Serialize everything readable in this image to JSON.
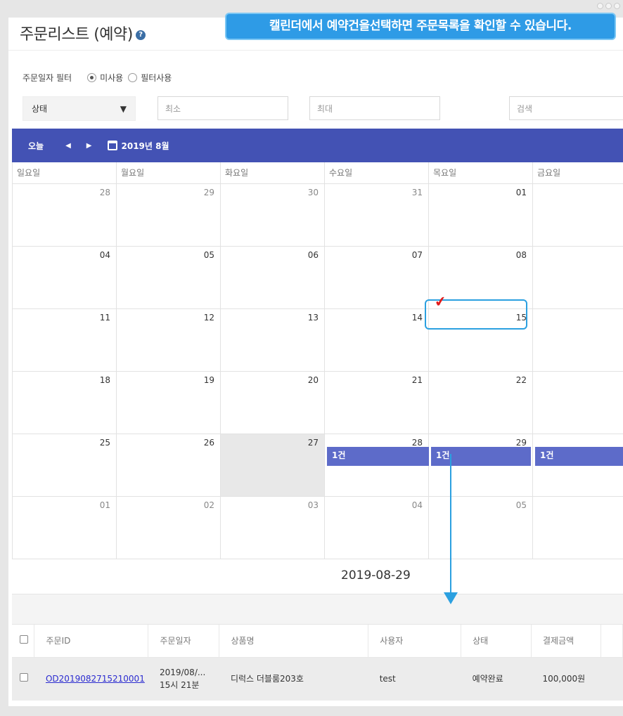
{
  "title": "주문리스트 (예약)",
  "callout": "캘린더에서 예약건을선택하면 주문목록을 확인할 수 있습니다.",
  "filter": {
    "label": "주문일자 필터",
    "options": [
      "미사용",
      "필터사용"
    ],
    "selected": "미사용"
  },
  "search": {
    "status_label": "상태",
    "min_placeholder": "최소",
    "max_placeholder": "최대",
    "search_placeholder": "검색"
  },
  "calendar": {
    "today_label": "오늘",
    "prev_icon": "◀",
    "next_icon": "▶",
    "month_label": "2019년 8월",
    "weekdays": [
      "일요일",
      "월요일",
      "화요일",
      "수요일",
      "목요일",
      "금요일"
    ],
    "weeks": [
      [
        "28",
        "29",
        "30",
        "31",
        "01",
        ""
      ],
      [
        "04",
        "05",
        "06",
        "07",
        "08",
        ""
      ],
      [
        "11",
        "12",
        "13",
        "14",
        "15",
        ""
      ],
      [
        "18",
        "19",
        "20",
        "21",
        "22",
        ""
      ],
      [
        "25",
        "26",
        "27",
        "28",
        "29",
        ""
      ],
      [
        "01",
        "02",
        "03",
        "04",
        "05",
        ""
      ]
    ],
    "events": [
      "1건",
      "1건",
      "1건"
    ]
  },
  "selected_date": "2019-08-29",
  "table": {
    "headers": [
      "주문ID",
      "주문일자",
      "상품명",
      "사용자",
      "상태",
      "결제금액"
    ],
    "rows": [
      {
        "order_id": "OD2019082715210001",
        "date_line1": "2019/08/...",
        "date_line2": "15시 21분",
        "product": "디럭스 더블룸203호",
        "user": "test",
        "status": "예약완료",
        "amount": "100,000원"
      }
    ]
  },
  "colors": {
    "toolbar": "#4352b4",
    "event": "#5d6bc9",
    "callout": "#2e9be6",
    "highlight": "#2ba0e0",
    "check": "#e21b1b"
  }
}
